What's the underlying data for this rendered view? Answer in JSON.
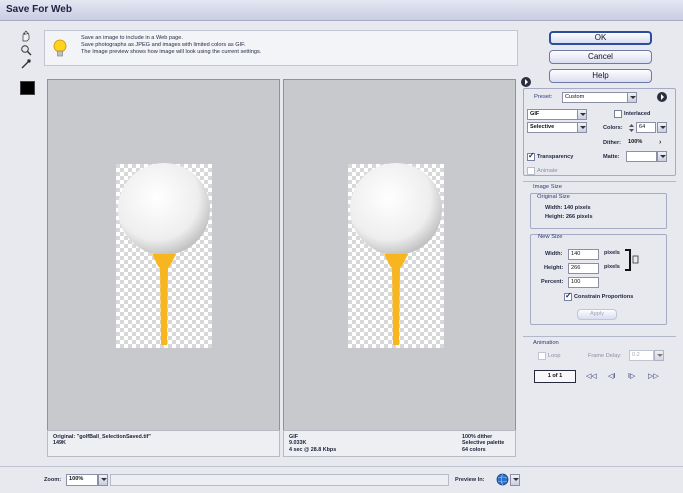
{
  "window": {
    "title": "Save For Web"
  },
  "tools": [
    {
      "name": "hand-tool-icon"
    },
    {
      "name": "zoom-tool-icon"
    },
    {
      "name": "eyedropper-tool-icon"
    }
  ],
  "info": {
    "lines": [
      "Save an image to include in a Web page.",
      "Save photographs as JPEG and images with limited colors as GIF.",
      "The Image preview shows how image will look using the current settings."
    ]
  },
  "buttons": {
    "ok": "OK",
    "cancel": "Cancel",
    "help": "Help"
  },
  "settings": {
    "preset_label": "Preset:",
    "preset_value": "Custom",
    "format": "GIF",
    "palette": "Selective",
    "interlaced_label": "Interlaced",
    "colors_label": "Colors:",
    "colors_value": "64",
    "dither_label": "Dither:",
    "dither_value": "100%",
    "transparency_label": "Transparency",
    "matte_label": "Matte:",
    "animate_label": "Animate"
  },
  "image_size": {
    "section_title": "Image Size",
    "original_title": "Original Size",
    "width_text": "Width: 140 pixels",
    "height_text": "Height: 266 pixels",
    "new_title": "New Size",
    "width_label": "Width:",
    "width_value": "140",
    "height_label": "Height:",
    "height_value": "266",
    "pixels_label": "pixels",
    "percent_label": "Percent:",
    "percent_value": "100",
    "constrain_label": "Constrain Proportions",
    "apply_label": "Apply"
  },
  "animation": {
    "section_title": "Animation",
    "loop_label": "Loop",
    "frame_delay_label": "Frame Delay:",
    "frame_delay_value": "0.2",
    "frame_counter": "1 of 1",
    "first_frame": "◁◁",
    "prev_frame": "◁I",
    "next_frame": "I▷",
    "last_frame": "▷▷"
  },
  "original_pane": {
    "line1": "Original: \"golfBall_SelectionSaved.tif\"",
    "line2": "149K"
  },
  "optimized_pane": {
    "left1": "GIF",
    "left2": "9.033K",
    "left3": "4 sec @ 28.8 Kbps",
    "right1": "100% dither",
    "right2": "Selective palette",
    "right3": "64 colors"
  },
  "status": {
    "zoom_label": "Zoom:",
    "zoom_value": "100%",
    "preview_label": "Preview In:"
  },
  "colors": {
    "tee": "#f7b51f",
    "accent_blue": "#2e4c9e"
  }
}
